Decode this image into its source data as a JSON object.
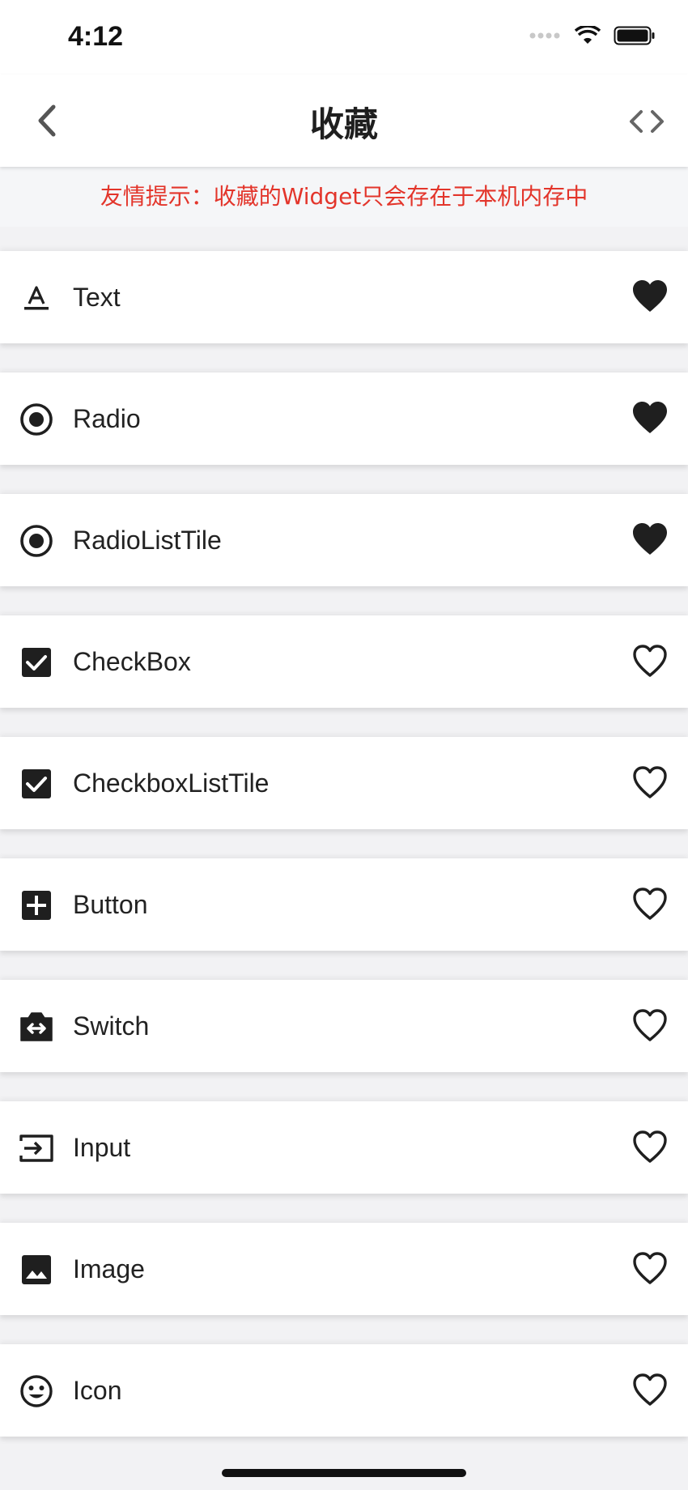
{
  "status_bar": {
    "time": "4:12"
  },
  "nav": {
    "title": "收藏"
  },
  "notice": "友情提示：收藏的Widget只会存在于本机内存中",
  "items": [
    {
      "label": "Text",
      "icon": "text-format-icon",
      "favorited": true
    },
    {
      "label": "Radio",
      "icon": "radio-checked-icon",
      "favorited": true
    },
    {
      "label": "RadioListTile",
      "icon": "radio-checked-icon",
      "favorited": true
    },
    {
      "label": "CheckBox",
      "icon": "checkbox-checked-icon",
      "favorited": false
    },
    {
      "label": "CheckboxListTile",
      "icon": "checkbox-checked-icon",
      "favorited": false
    },
    {
      "label": "Button",
      "icon": "add-box-icon",
      "favorited": false
    },
    {
      "label": "Switch",
      "icon": "switch-camera-icon",
      "favorited": false
    },
    {
      "label": "Input",
      "icon": "input-icon",
      "favorited": false
    },
    {
      "label": "Image",
      "icon": "image-icon",
      "favorited": false
    },
    {
      "label": "Icon",
      "icon": "smiley-icon",
      "favorited": false
    }
  ],
  "colors": {
    "notice_text": "#e3352b",
    "icon": "#1f1f1f",
    "background": "#f2f2f4"
  }
}
